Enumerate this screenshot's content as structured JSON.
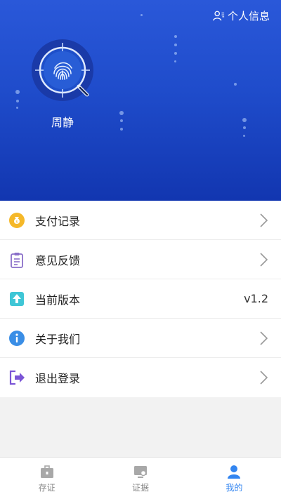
{
  "header": {
    "profile_link_label": "个人信息",
    "username": "周静",
    "bg_color": "#1f4ccb"
  },
  "menu": [
    {
      "label": "支付记录",
      "icon": "money-bag-icon",
      "icon_color": "#f5b829",
      "trailing": "chevron"
    },
    {
      "label": "意见反馈",
      "icon": "clipboard-icon",
      "icon_color": "#8a6fc9",
      "trailing": "chevron"
    },
    {
      "label": "当前版本",
      "icon": "upload-icon",
      "icon_color": "#3fc6d6",
      "trailing": "value",
      "value": "v1.2"
    },
    {
      "label": "关于我们",
      "icon": "info-icon",
      "icon_color": "#3a8ee6",
      "trailing": "chevron"
    },
    {
      "label": "退出登录",
      "icon": "logout-icon",
      "icon_color": "#7b55d6",
      "trailing": "chevron"
    }
  ],
  "tabbar": {
    "tabs": [
      {
        "label": "存证",
        "icon": "briefcase-icon",
        "active": false
      },
      {
        "label": "证据",
        "icon": "monitor-icon",
        "active": false
      },
      {
        "label": "我的",
        "icon": "person-icon",
        "active": true
      }
    ],
    "active_color": "#3385f0",
    "inactive_color": "#888888"
  }
}
